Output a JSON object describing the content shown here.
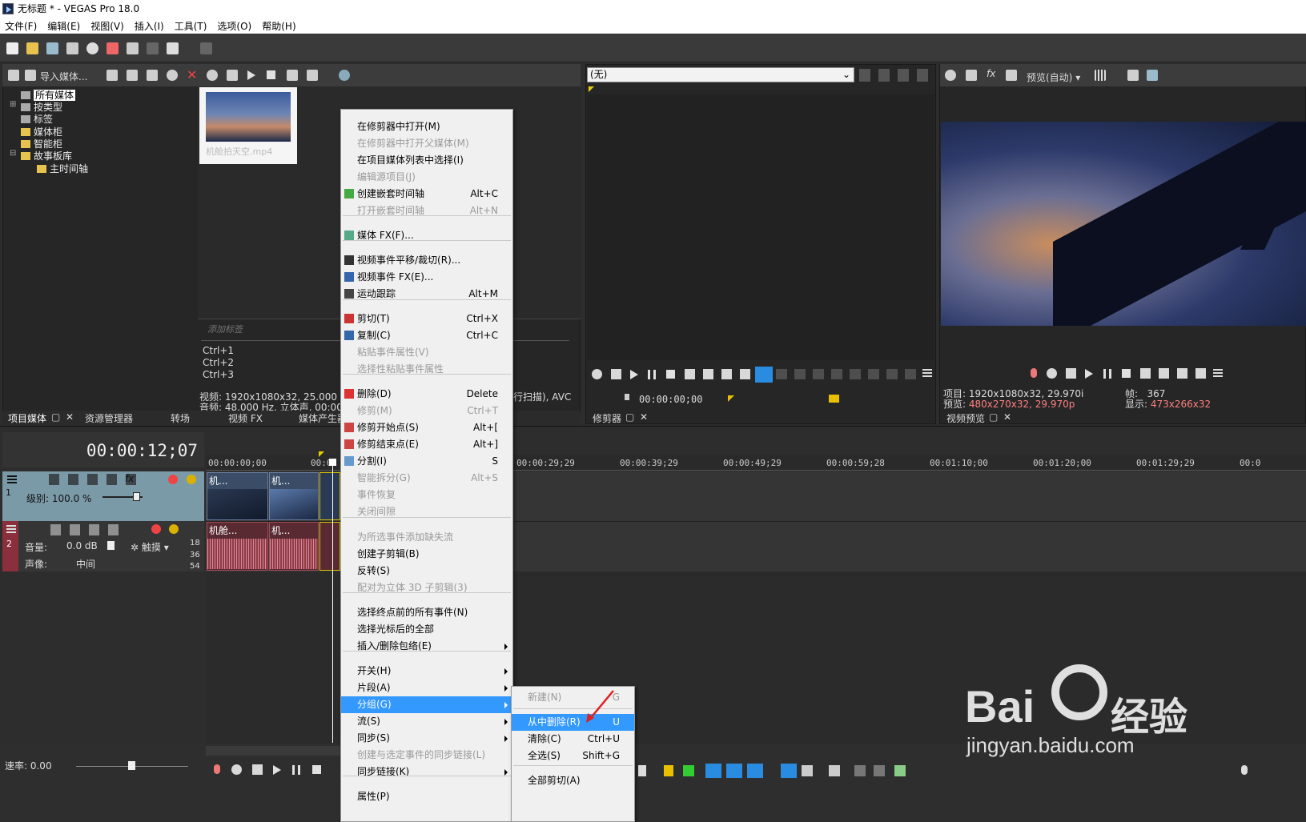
{
  "window": {
    "title": "无标题 * - VEGAS Pro 18.0"
  },
  "menubar": [
    "文件(F)",
    "编辑(E)",
    "视图(V)",
    "插入(I)",
    "工具(T)",
    "选项(O)",
    "帮助(H)"
  ],
  "media_panel": {
    "import_label": "导入媒体...",
    "tree": [
      "所有媒体",
      "按类型",
      "标签",
      "媒体柜",
      "智能柜",
      "故事板库",
      "主时间轴"
    ],
    "clip_name": "机舱拍天空.mp4",
    "tag_placeholder": "添加标签",
    "shortcuts": [
      "Ctrl+1",
      "Ctrl+2",
      "Ctrl+3"
    ],
    "info_line1": "视频: 1920x1080x32, 25.000 fps",
    "info_line2": "音频: 48,000 Hz, 立体声, 00:00:",
    "info_right": "行扫描), AVC",
    "tabs": [
      "项目媒体",
      "资源管理器",
      "转场",
      "视频 FX",
      "媒体产生器"
    ]
  },
  "trimmer": {
    "dropdown": "(无)",
    "timecode": "00:00:00;00",
    "tab": "修剪器"
  },
  "preview": {
    "mode": "预览(自动)",
    "project_label": "项目:",
    "project_value": "1920x1080x32, 29.970i",
    "preview_label": "预览:",
    "preview_value": "480x270x32, 29.970p",
    "frame_label": "帧:",
    "frame_value": "367",
    "display_label": "显示:",
    "display_value": "473x266x32",
    "tab": "视频预览"
  },
  "timeline": {
    "timecode": "00:00:12;07",
    "ruler": [
      "00:00:00;00",
      "00:0",
      "00:00:29;29",
      "00:00:39;29",
      "00:00:49;29",
      "00:00:59;28",
      "00:01:10;00",
      "00:01:20;00",
      "00:01:29;29",
      "00:0"
    ],
    "video_track": {
      "num": "1",
      "level": "级别: 100.0 %",
      "clip1": "机...",
      "clip2": "机..."
    },
    "audio_track": {
      "num": "2",
      "volume_label": "音量:",
      "volume": "0.0 dB",
      "pan_label": "声像:",
      "pan": "中间",
      "mode": "触摸",
      "clip1": "机舱...",
      "clip2": "机...",
      "db": [
        "18",
        "36",
        "54"
      ]
    },
    "rate": "速率: 0.00"
  },
  "context_menu": {
    "items": [
      {
        "label": "在修剪器中打开(M)",
        "shortcut": "",
        "disabled": false
      },
      {
        "label": "在修剪器中打开父媒体(M)",
        "shortcut": "",
        "disabled": true
      },
      {
        "label": "在项目媒体列表中选择(I)",
        "shortcut": "",
        "disabled": false
      },
      {
        "label": "编辑源项目(J)",
        "shortcut": "",
        "disabled": true
      },
      {
        "label": "创建嵌套时间轴",
        "shortcut": "Alt+C",
        "disabled": false
      },
      {
        "label": "打开嵌套时间轴",
        "shortcut": "Alt+N",
        "disabled": true
      },
      {
        "label": "媒体 FX(F)...",
        "shortcut": "",
        "disabled": false
      },
      {
        "label": "视频事件平移/裁切(R)...",
        "shortcut": "",
        "disabled": false
      },
      {
        "label": "视频事件 FX(E)...",
        "shortcut": "",
        "disabled": false
      },
      {
        "label": "运动跟踪",
        "shortcut": "Alt+M",
        "disabled": false
      },
      {
        "label": "剪切(T)",
        "shortcut": "Ctrl+X",
        "disabled": false
      },
      {
        "label": "复制(C)",
        "shortcut": "Ctrl+C",
        "disabled": false
      },
      {
        "label": "粘贴事件属性(V)",
        "shortcut": "",
        "disabled": true
      },
      {
        "label": "选择性粘贴事件属性",
        "shortcut": "",
        "disabled": true
      },
      {
        "label": "删除(D)",
        "shortcut": "Delete",
        "disabled": false
      },
      {
        "label": "修剪(M)",
        "shortcut": "Ctrl+T",
        "disabled": true
      },
      {
        "label": "修剪开始点(S)",
        "shortcut": "Alt+[",
        "disabled": false
      },
      {
        "label": "修剪结束点(E)",
        "shortcut": "Alt+]",
        "disabled": false
      },
      {
        "label": "分割(I)",
        "shortcut": "S",
        "disabled": false
      },
      {
        "label": "智能拆分(G)",
        "shortcut": "Alt+S",
        "disabled": true
      },
      {
        "label": "事件恢复",
        "shortcut": "",
        "disabled": true
      },
      {
        "label": "关闭间隙",
        "shortcut": "",
        "disabled": true
      },
      {
        "label": "为所选事件添加缺失流",
        "shortcut": "",
        "disabled": true
      },
      {
        "label": "创建子剪辑(B)",
        "shortcut": "",
        "disabled": false
      },
      {
        "label": "反转(S)",
        "shortcut": "",
        "disabled": false
      },
      {
        "label": "配对为立体 3D 子剪辑(3)",
        "shortcut": "",
        "disabled": true
      },
      {
        "label": "选择终点前的所有事件(N)",
        "shortcut": "",
        "disabled": false
      },
      {
        "label": "选择光标后的全部",
        "shortcut": "",
        "disabled": false
      },
      {
        "label": "插入/删除包络(E)",
        "shortcut": "",
        "disabled": false
      },
      {
        "label": "开关(H)",
        "shortcut": "",
        "disabled": false
      },
      {
        "label": "片段(A)",
        "shortcut": "",
        "disabled": false
      },
      {
        "label": "分组(G)",
        "shortcut": "",
        "disabled": false
      },
      {
        "label": "流(S)",
        "shortcut": "",
        "disabled": false
      },
      {
        "label": "同步(S)",
        "shortcut": "",
        "disabled": false
      },
      {
        "label": "创建与选定事件的同步链接(L)",
        "shortcut": "",
        "disabled": true
      },
      {
        "label": "同步链接(K)",
        "shortcut": "",
        "disabled": false
      },
      {
        "label": "属性(P)",
        "shortcut": "",
        "disabled": false
      }
    ]
  },
  "submenu": {
    "items": [
      {
        "label": "新建(N)",
        "shortcut": "G",
        "disabled": true
      },
      {
        "label": "从中删除(R)",
        "shortcut": "U",
        "disabled": false
      },
      {
        "label": "清除(C)",
        "shortcut": "Ctrl+U",
        "disabled": false
      },
      {
        "label": "全选(S)",
        "shortcut": "Shift+G",
        "disabled": false
      },
      {
        "label": "全部剪切(A)",
        "shortcut": "",
        "disabled": false
      }
    ]
  },
  "watermark": {
    "brand": "Bai",
    "brand2": "经验",
    "url": "jingyan.baidu.com"
  },
  "colors": {
    "highlight": "#3399ff",
    "preview_value": "#ff8080",
    "video_track": "#7b9aa8",
    "audio_track": "#8a2f3c"
  }
}
